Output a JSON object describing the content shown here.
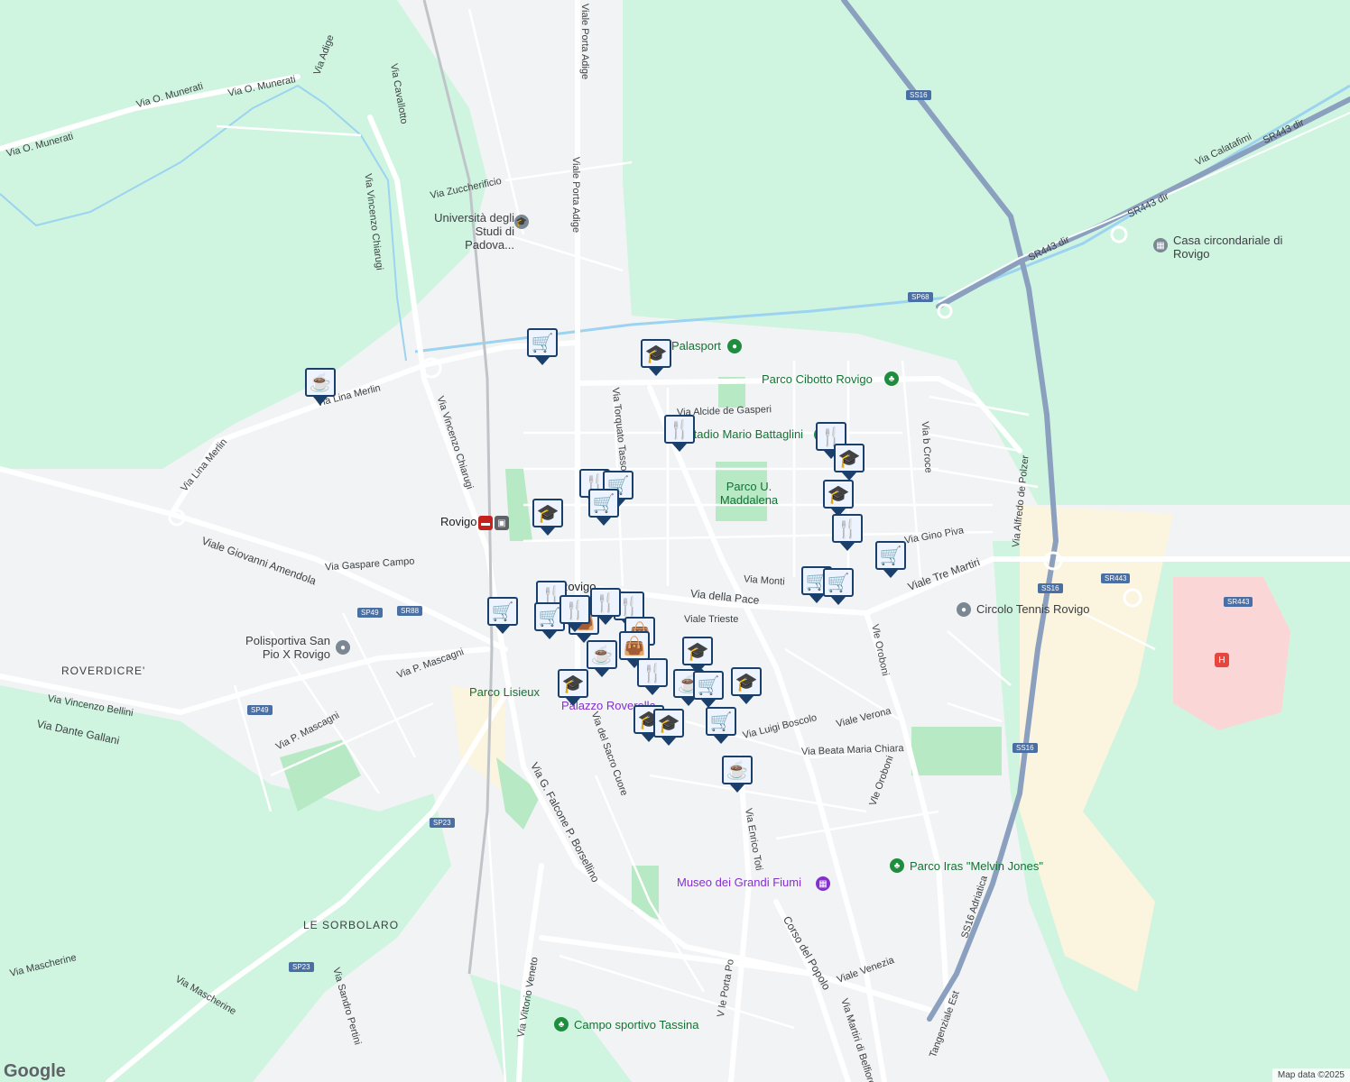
{
  "map": {
    "attribution": "Map data ©2025",
    "logo": "Google"
  },
  "colors": {
    "land": "#f1f3f4",
    "green": "#cff5e0",
    "park": "#b6e9c4",
    "water": "#9cd3f0",
    "road": "#ffffff",
    "highway": "#8aa0be",
    "urban": "#fbf4df",
    "hospital": "#fbd6d6",
    "marker": "#1a3f6b"
  },
  "streets": [
    {
      "id": "o-munerati-1",
      "text": "Via O. Munerati"
    },
    {
      "id": "o-munerati-2",
      "text": "Via O. Munerati"
    },
    {
      "id": "o-munerati-3",
      "text": "Via O. Munerati"
    },
    {
      "id": "adige",
      "text": "Via Adige"
    },
    {
      "id": "cavallotto",
      "text": "Via Cavallotto"
    },
    {
      "id": "viale-porta-adige-1",
      "text": "Viale Porta Adige"
    },
    {
      "id": "viale-porta-adige-2",
      "text": "Viale Porta Adige"
    },
    {
      "id": "chiarugi-1",
      "text": "Via Vincenzo Chiarugi"
    },
    {
      "id": "chiarugi-2",
      "text": "Via Vincenzo Chiarugi"
    },
    {
      "id": "zuccherificio",
      "text": "Via Zuccherificio"
    },
    {
      "id": "lina-merlin-1",
      "text": "Via Lina Merlin"
    },
    {
      "id": "lina-merlin-2",
      "text": "Via Lina Merlin"
    },
    {
      "id": "amendola",
      "text": "Viale Giovanni Amendola"
    },
    {
      "id": "gaspare-campo",
      "text": "Via Gaspare Campo"
    },
    {
      "id": "mascagni-1",
      "text": "Via P. Mascagni"
    },
    {
      "id": "mascagni-2",
      "text": "Via P. Mascagni"
    },
    {
      "id": "bellini",
      "text": "Via Vincenzo Bellini"
    },
    {
      "id": "gallani",
      "text": "Via Dante Gallani"
    },
    {
      "id": "tasso",
      "text": "Via Torquato Tasso"
    },
    {
      "id": "de-gasperi",
      "text": "Via Alcide de Gasperi"
    },
    {
      "id": "della-pace",
      "text": "Via della Pace"
    },
    {
      "id": "monti",
      "text": "Via Monti"
    },
    {
      "id": "trieste",
      "text": "Viale Trieste"
    },
    {
      "id": "gino-piva",
      "text": "Via Gino Piva"
    },
    {
      "id": "b-croce",
      "text": "Via b Croce"
    },
    {
      "id": "de-polzer",
      "text": "Via Alfredo de Polzer"
    },
    {
      "id": "tre-martiri",
      "text": "Viale Tre Martiri"
    },
    {
      "id": "oroboni-1",
      "text": "Vle Oroboni"
    },
    {
      "id": "oroboni-2",
      "text": "Vle Oroboni"
    },
    {
      "id": "sacro-cuore",
      "text": "Via del Sacro Cuore"
    },
    {
      "id": "luigi-boscolo",
      "text": "Via Luigi Boscolo"
    },
    {
      "id": "viale-verona",
      "text": "Viale Verona"
    },
    {
      "id": "beata-maria",
      "text": "Via Beata Maria Chiara"
    },
    {
      "id": "enrico-toti",
      "text": "Via Enrico Toti"
    },
    {
      "id": "falcone",
      "text": "Via G. Falcone P. Borsellino"
    },
    {
      "id": "corso-popolo",
      "text": "Corso del Popolo"
    },
    {
      "id": "viale-venezia",
      "text": "Viale Venezia"
    },
    {
      "id": "porta-po",
      "text": "V le Porta Po"
    },
    {
      "id": "vittorio-veneto",
      "text": "Via Vittorio Veneto"
    },
    {
      "id": "mascherine-1",
      "text": "Via Mascherine"
    },
    {
      "id": "mascherine-2",
      "text": "Via Mascherine"
    },
    {
      "id": "pertini",
      "text": "Via Sandro Pertini"
    },
    {
      "id": "martiri-belfiore",
      "text": "Via Martiri di Belfiore"
    },
    {
      "id": "calatafimi",
      "text": "Via Calatafimi"
    },
    {
      "id": "sr443dir-1",
      "text": "SR443 dir"
    },
    {
      "id": "sr443dir-2",
      "text": "SR443 dir"
    },
    {
      "id": "sr443dir-3",
      "text": "SR443 dir"
    },
    {
      "id": "adriatica",
      "text": "SS16 Adriatica"
    },
    {
      "id": "tangenziale",
      "text": "Tangenziale Est"
    }
  ],
  "shields": [
    {
      "id": "ss16-top",
      "text": "SS16"
    },
    {
      "id": "sp68",
      "text": "SP68"
    },
    {
      "id": "ss16-mid",
      "text": "SS16"
    },
    {
      "id": "sr443",
      "text": "SR443"
    },
    {
      "id": "sr443-right",
      "text": "SR443"
    },
    {
      "id": "ss16-low",
      "text": "SS16"
    },
    {
      "id": "sp49-top",
      "text": "SP49"
    },
    {
      "id": "sr88",
      "text": "SR88"
    },
    {
      "id": "sp49-low",
      "text": "SP49"
    },
    {
      "id": "sp23-top",
      "text": "SP23"
    },
    {
      "id": "sp23-low",
      "text": "SP23"
    }
  ],
  "places": [
    {
      "id": "universita",
      "text": "Università degli Studi di Padova..."
    },
    {
      "id": "palasport",
      "text": "Palasport"
    },
    {
      "id": "parco-cibotto",
      "text": "Parco Cibotto Rovigo"
    },
    {
      "id": "stadio",
      "text": "Stadio Mario Battaglini"
    },
    {
      "id": "parco-maddalena",
      "text": "Parco U. Maddalena"
    },
    {
      "id": "casa-circondariale",
      "text": "Casa circondariale di Rovigo"
    },
    {
      "id": "circolo-tennis",
      "text": "Circolo Tennis Rovigo"
    },
    {
      "id": "rovigo-station",
      "text": "Rovigo"
    },
    {
      "id": "rovigo-center",
      "text": "Rovigo"
    },
    {
      "id": "polisportiva",
      "text": "Polisportiva San Pio X Rovigo"
    },
    {
      "id": "roverdicre",
      "text": "ROVERDICRE'"
    },
    {
      "id": "parco-lisieux",
      "text": "Parco Lisieux"
    },
    {
      "id": "palazzo-roverella",
      "text": "Palazzo Roverella"
    },
    {
      "id": "museo",
      "text": "Museo dei Grandi Fiumi"
    },
    {
      "id": "parco-iras",
      "text": "Parco Iras \"Melvin Jones\""
    },
    {
      "id": "le-sorbolaro",
      "text": "LE SORBOLARO"
    },
    {
      "id": "campo-tassina",
      "text": "Campo sportivo Tassina"
    }
  ],
  "markers": [
    {
      "type": "cart",
      "icon": "shopping-cart-icon"
    },
    {
      "type": "cup",
      "icon": "coffee-cup-icon"
    },
    {
      "type": "school",
      "icon": "graduation-cap-icon"
    },
    {
      "type": "fork",
      "icon": "fork-knife-icon"
    },
    {
      "type": "fork",
      "icon": "fork-knife-icon"
    },
    {
      "type": "school",
      "icon": "graduation-cap-icon"
    },
    {
      "type": "school",
      "icon": "graduation-cap-icon"
    },
    {
      "type": "fork",
      "icon": "fork-knife-icon"
    },
    {
      "type": "fork",
      "icon": "fork-knife-icon"
    },
    {
      "type": "cart",
      "icon": "shopping-cart-icon"
    },
    {
      "type": "cart",
      "icon": "shopping-cart-icon"
    },
    {
      "type": "school",
      "icon": "graduation-cap-icon"
    },
    {
      "type": "cart",
      "icon": "shopping-cart-icon"
    },
    {
      "type": "cart",
      "icon": "shopping-cart-icon"
    },
    {
      "type": "cart",
      "icon": "shopping-cart-icon"
    },
    {
      "type": "cart",
      "icon": "shopping-cart-icon"
    },
    {
      "type": "fork",
      "icon": "fork-knife-icon"
    },
    {
      "type": "cart",
      "icon": "shopping-cart-icon"
    },
    {
      "type": "fork",
      "icon": "fork-knife-icon"
    },
    {
      "type": "bag",
      "icon": "shopping-bag-icon"
    },
    {
      "type": "fork",
      "icon": "fork-knife-icon"
    },
    {
      "type": "fork",
      "icon": "fork-knife-icon"
    },
    {
      "type": "bag",
      "icon": "shopping-bag-icon"
    },
    {
      "type": "bag",
      "icon": "shopping-bag-icon"
    },
    {
      "type": "cup",
      "icon": "coffee-cup-icon"
    },
    {
      "type": "school",
      "icon": "graduation-cap-icon"
    },
    {
      "type": "school",
      "icon": "graduation-cap-icon"
    },
    {
      "type": "fork",
      "icon": "fork-knife-icon"
    },
    {
      "type": "cup",
      "icon": "coffee-cup-icon"
    },
    {
      "type": "cart",
      "icon": "shopping-cart-icon"
    },
    {
      "type": "school",
      "icon": "graduation-cap-icon"
    },
    {
      "type": "school",
      "icon": "graduation-cap-icon"
    },
    {
      "type": "school",
      "icon": "graduation-cap-icon"
    },
    {
      "type": "cart",
      "icon": "shopping-cart-icon"
    },
    {
      "type": "cup",
      "icon": "coffee-cup-icon"
    }
  ]
}
